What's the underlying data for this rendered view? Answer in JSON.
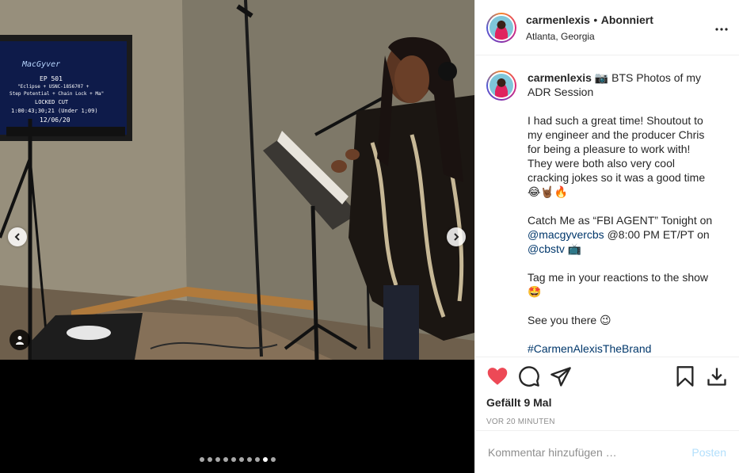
{
  "post": {
    "username": "carmenlexis",
    "separator": "•",
    "follow_status": "Abonniert",
    "location": "Atlanta, Georgia",
    "more_icon": "more-horizontal-icon"
  },
  "tv_screen": {
    "logo": "MacGyver",
    "ep": "EP 501",
    "line1": "\"Eclipse + USNC-1856707 +",
    "line2": "Step Potential + Chain Lock + Ma\"",
    "line3": "LOCKED CUT",
    "line4": "1:00:43;30;21  (Under 1;09)",
    "line5": "12/06/20"
  },
  "caption": {
    "username": "carmenlexis",
    "title": "📷 BTS Photos of my ADR Session",
    "para1": "I had such a great time! Shoutout to my engineer and the producer Chris for being a pleasure to work with! They were both also very cool cracking jokes so it was a good time 😂🤘🏾🔥",
    "para2_a": "Catch Me as “FBI AGENT” Tonight on ",
    "mention1": "@macgyvercbs",
    "para2_b": " @8:00 PM ET/PT on ",
    "mention2": "@cbstv",
    "para2_c": " 📺",
    "para3": "Tag me in your reactions to the show 🤩",
    "para4": "See you there 😉",
    "hashtag": "#CarmenAlexisTheBrand"
  },
  "actions": {
    "like_icon": "heart-filled-icon",
    "comment_icon": "comment-icon",
    "share_icon": "paper-plane-icon",
    "save_icon": "bookmark-icon",
    "download_icon": "download-icon",
    "likes_text": "Gefällt 9 Mal",
    "time_text": "VOR 20 MINUTEN"
  },
  "comment": {
    "placeholder": "Kommentar hinzufügen …",
    "post_label": "Posten"
  },
  "carousel": {
    "total": 10,
    "active_index": 8
  },
  "colors": {
    "like_red": "#ed4956",
    "mention_blue": "#00376b",
    "post_disabled": "#b2dffc"
  }
}
